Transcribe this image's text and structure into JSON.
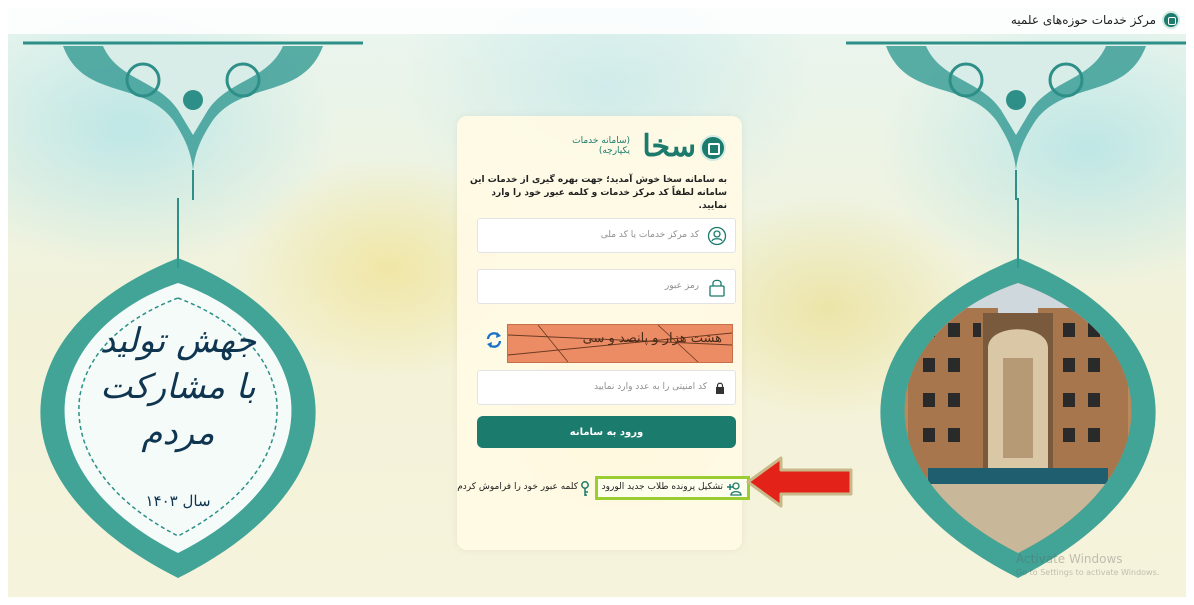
{
  "header": {
    "title": "مرکز خدمات حوزه‌های علمیه",
    "logo_icon": "seminary-logo-icon"
  },
  "decor": {
    "left_panel_title": "جهش تولید با مشارکت مردم",
    "left_panel_year": "سال ۱۴۰۳",
    "right_panel_image": "building-photo"
  },
  "login": {
    "brand_name": "سخا",
    "brand_subtitle": "(سامانه خدمات یکپارچه)",
    "intro_text": "به سامانه سخا خوش آمدید؛ جهت بهره گیری از خدمات این سامانه لطفاً کد مرکز خدمات و کلمه عبور خود را وارد نمایید.",
    "username_placeholder": "کد مرکز خدمات یا کد ملی",
    "password_placeholder": "رمز عبور",
    "captcha_text": "هشت هزار و پانصد و سی",
    "captcha_placeholder": "کد امنیتی را به عدد وارد نمایید",
    "submit_label": "ورود به سامانه",
    "register_link": "تشکیل پرونده طلاب جدید الورود",
    "forgot_link": "کلمه عبور خود را فراموش کردم"
  },
  "watermark": {
    "title": "Activate Windows",
    "subtitle": "Go to Settings to activate Windows."
  },
  "colors": {
    "brand": "#1b7b6d",
    "highlight_border": "#9acd32",
    "arrow": "#e3231a",
    "captcha_bg": "#ec8c64"
  }
}
